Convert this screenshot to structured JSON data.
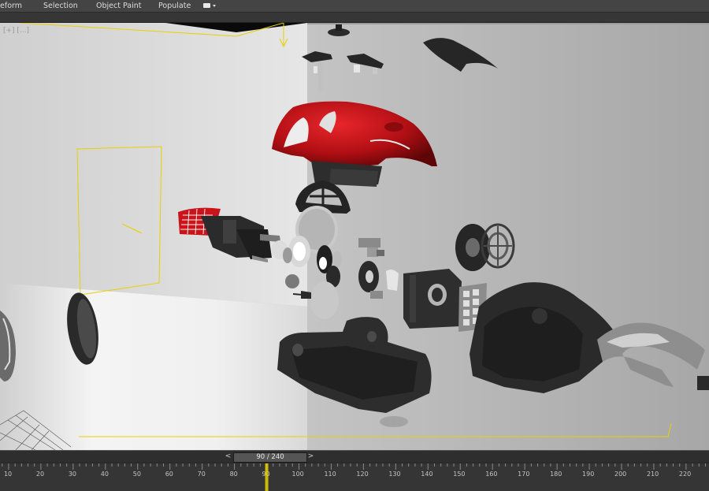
{
  "menubar": {
    "items": [
      "eform",
      "Selection",
      "Object Paint",
      "Populate"
    ],
    "extra_icon": "display-dropdown-icon"
  },
  "viewport": {
    "label": "[+] [...]"
  },
  "timeline": {
    "frame_text": "90 / 240",
    "prev_symbol": "<",
    "next_symbol": ">",
    "current_frame": 90,
    "total_frames": 240,
    "ruler_labels": [
      "10",
      "20",
      "30",
      "40",
      "50",
      "60",
      "70",
      "80",
      "90",
      "100",
      "110",
      "120",
      "130",
      "140",
      "150",
      "160",
      "170",
      "180",
      "190",
      "200",
      "210",
      "220"
    ]
  },
  "colors": {
    "highlight": "#e8d000",
    "red_part": "#c8141a",
    "dark_part": "#2c2c2c"
  }
}
